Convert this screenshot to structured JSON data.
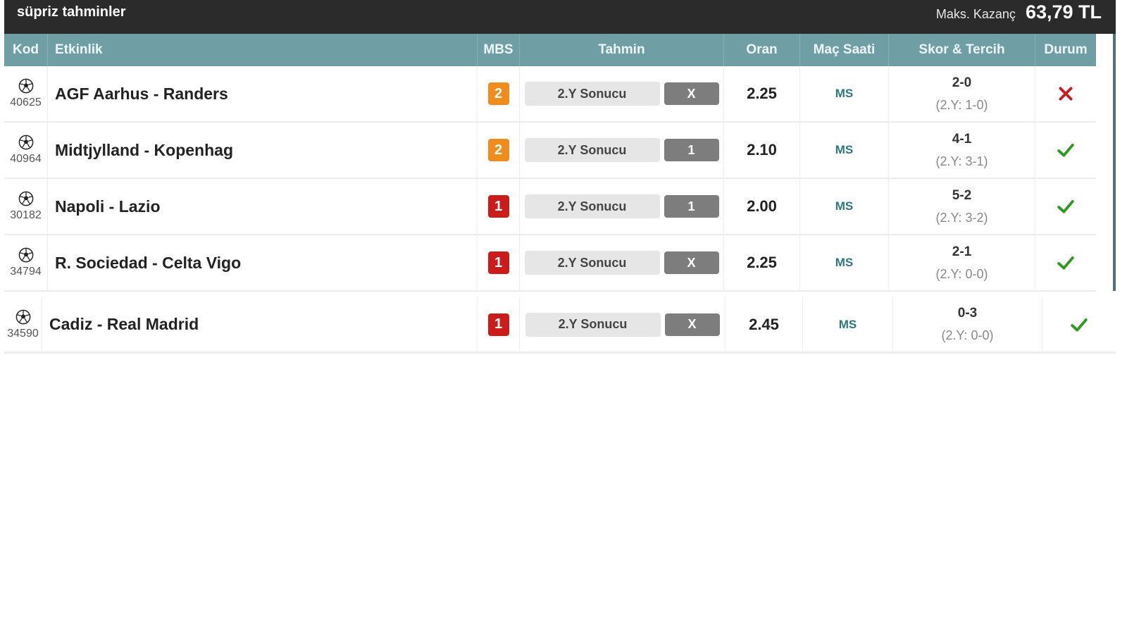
{
  "header": {
    "title": "süpriz tahminler",
    "max_label": "Maks. Kazanç",
    "max_value": "63,79 TL"
  },
  "columns": {
    "kod": "Kod",
    "etkinlik": "Etkinlik",
    "mbs": "MBS",
    "tahmin": "Tahmin",
    "oran": "Oran",
    "mac_saati": "Maç Saati",
    "skor": "Skor & Tercih",
    "durum": "Durum"
  },
  "rows": [
    {
      "code": "40625",
      "event": "AGF Aarhus - Randers",
      "mbs": "2",
      "mbs_color": "#f08c1c",
      "tahmin": "2.Y Sonucu",
      "choice": "X",
      "oran": "2.25",
      "saat": "MS",
      "score": "2-0",
      "half": "(2.Y: 1-0)",
      "status": "lost"
    },
    {
      "code": "40964",
      "event": "Midtjylland - Kopenhag",
      "mbs": "2",
      "mbs_color": "#f08c1c",
      "tahmin": "2.Y Sonucu",
      "choice": "1",
      "oran": "2.10",
      "saat": "MS",
      "score": "4-1",
      "half": "(2.Y: 3-1)",
      "status": "won"
    },
    {
      "code": "30182",
      "event": "Napoli - Lazio",
      "mbs": "1",
      "mbs_color": "#cc1b1b",
      "tahmin": "2.Y Sonucu",
      "choice": "1",
      "oran": "2.00",
      "saat": "MS",
      "score": "5-2",
      "half": "(2.Y: 3-2)",
      "status": "won"
    },
    {
      "code": "34794",
      "event": "R. Sociedad - Celta Vigo",
      "mbs": "1",
      "mbs_color": "#cc1b1b",
      "tahmin": "2.Y Sonucu",
      "choice": "X",
      "oran": "2.25",
      "saat": "MS",
      "score": "2-1",
      "half": "(2.Y: 0-0)",
      "status": "won"
    },
    {
      "code": "34590",
      "event": "Cadiz - Real Madrid",
      "mbs": "1",
      "mbs_color": "#cc1b1b",
      "tahmin": "2.Y Sonucu",
      "choice": "X",
      "oran": "2.45",
      "saat": "MS",
      "score": "0-3",
      "half": "(2.Y: 0-0)",
      "status": "won"
    }
  ],
  "icons": {
    "ball": "soccer-ball-icon",
    "won": "check-icon",
    "lost": "cross-icon"
  },
  "colors": {
    "header_bg": "#2b2b2b",
    "column_header_bg": "#6f9fa5",
    "won": "#2e9a1f",
    "lost": "#c81e1e"
  }
}
